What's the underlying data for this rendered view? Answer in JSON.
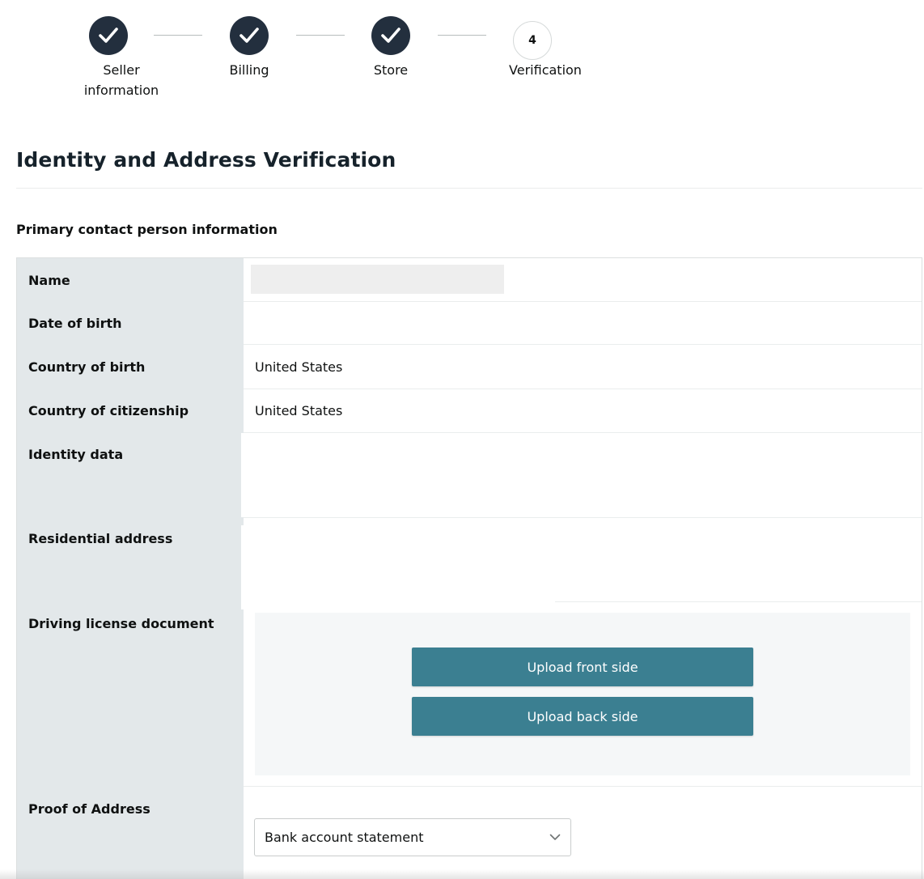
{
  "stepper": {
    "steps": [
      {
        "label_line1": "Seller",
        "label_line2": "information",
        "state": "done"
      },
      {
        "label_line1": "Billing",
        "label_line2": "",
        "state": "done"
      },
      {
        "label_line1": "Store",
        "label_line2": "",
        "state": "done"
      },
      {
        "number": "4",
        "label_line1": "Verification",
        "label_line2": "",
        "state": "current"
      }
    ]
  },
  "page": {
    "title": "Identity and Address Verification",
    "section_title": "Primary contact person information"
  },
  "info_table": {
    "rows": [
      {
        "label": "Name",
        "value": ""
      },
      {
        "label": "Date of birth",
        "value": ""
      },
      {
        "label": "Country of birth",
        "value": "United States"
      },
      {
        "label": "Country of citizenship",
        "value": "United States"
      },
      {
        "label": "Identity data",
        "value": ""
      },
      {
        "label": "Residential address",
        "value": ""
      },
      {
        "label": "Driving license document",
        "value": ""
      },
      {
        "label": "Proof of Address",
        "value": ""
      }
    ]
  },
  "driving_license": {
    "upload_front_label": "Upload front side",
    "upload_back_label": "Upload back side"
  },
  "proof_of_address": {
    "selected": "Bank account statement"
  },
  "colors": {
    "step_done": "#232f3e",
    "label_column": "#e3e8ea",
    "upload_button": "#3b7f91",
    "upload_panel": "#f5f7f8"
  }
}
